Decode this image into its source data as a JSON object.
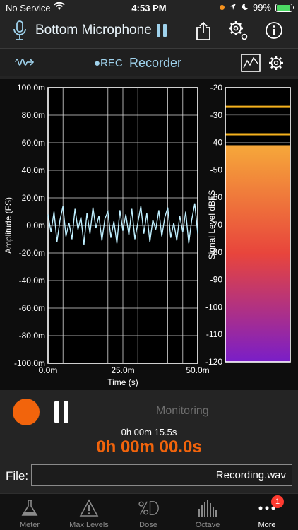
{
  "status": {
    "carrier": "No Service",
    "time": "4:53 PM",
    "battery_text": "99%",
    "battery_level": 0.99
  },
  "header": {
    "mic_name": "Bottom Microphone"
  },
  "subheader": {
    "rec_label": "●REC",
    "title": "Recorder"
  },
  "chart_data": [
    {
      "type": "line",
      "xlabel": "Time (s)",
      "ylabel": "Amplitude (FS)",
      "xlim": [
        0,
        50
      ],
      "ylim": [
        -100,
        100
      ],
      "x_unit": "m",
      "y_unit": "m",
      "x_ticks": [
        "0.0m",
        "25.0m",
        "50.0m"
      ],
      "y_ticks": [
        "100.0m",
        "80.0m",
        "60.0m",
        "40.0m",
        "20.0m",
        "0.0m",
        "-20.0m",
        "-40.0m",
        "-60.0m",
        "-80.0m",
        "-100.0m"
      ],
      "grid": true,
      "series": [
        {
          "color": "#bfefff",
          "x": [
            0,
            1,
            2,
            3,
            4,
            5,
            6,
            7,
            8,
            9,
            10,
            11,
            12,
            13,
            14,
            15,
            16,
            17,
            18,
            19,
            20,
            21,
            22,
            23,
            24,
            25,
            26,
            27,
            28,
            29,
            30,
            31,
            32,
            33,
            34,
            35,
            36,
            37,
            38,
            39,
            40,
            41,
            42,
            43,
            44,
            45,
            46,
            47,
            48,
            49,
            50
          ],
          "y": [
            8,
            -5,
            10,
            -12,
            4,
            14,
            -8,
            2,
            -10,
            12,
            -3,
            6,
            -14,
            9,
            -6,
            13,
            -2,
            7,
            -11,
            5,
            10,
            -9,
            3,
            -13,
            11,
            -4,
            8,
            -7,
            12,
            -10,
            2,
            14,
            -6,
            9,
            -12,
            4,
            -3,
            11,
            -8,
            6,
            13,
            -9,
            2,
            -11,
            7,
            -5,
            10,
            -13,
            4,
            16,
            -6
          ]
        }
      ]
    },
    {
      "type": "bar",
      "ylabel": "Signal Level dBFS",
      "ylim": [
        -120,
        -20
      ],
      "y_ticks": [
        "-20",
        "-30",
        "-40",
        "-50",
        "-60",
        "-70",
        "-80",
        "-90",
        "-100",
        "-110",
        "-120"
      ],
      "level_db": -41,
      "peak_hold_db": -27,
      "peak_db": -37,
      "colors": {
        "top": "#f6a83a",
        "mid": "#e8453c",
        "bottom": "#7a1ec8",
        "peak": "#f5b21d"
      }
    }
  ],
  "transport": {
    "state_label": "Monitoring",
    "elapsed_small": "0h 00m 15.5s",
    "elapsed_big": "0h 00m 00.0s"
  },
  "file": {
    "label": "File:",
    "value": "Recording.wav"
  },
  "tabs": [
    {
      "label": "Meter",
      "icon": "flask-icon"
    },
    {
      "label": "Max Levels",
      "icon": "warning-icon"
    },
    {
      "label": "Dose",
      "icon": "percent-d-icon"
    },
    {
      "label": "Octave",
      "icon": "octave-bars-icon"
    },
    {
      "label": "More",
      "icon": "more-dots-icon",
      "badge": "1"
    }
  ]
}
